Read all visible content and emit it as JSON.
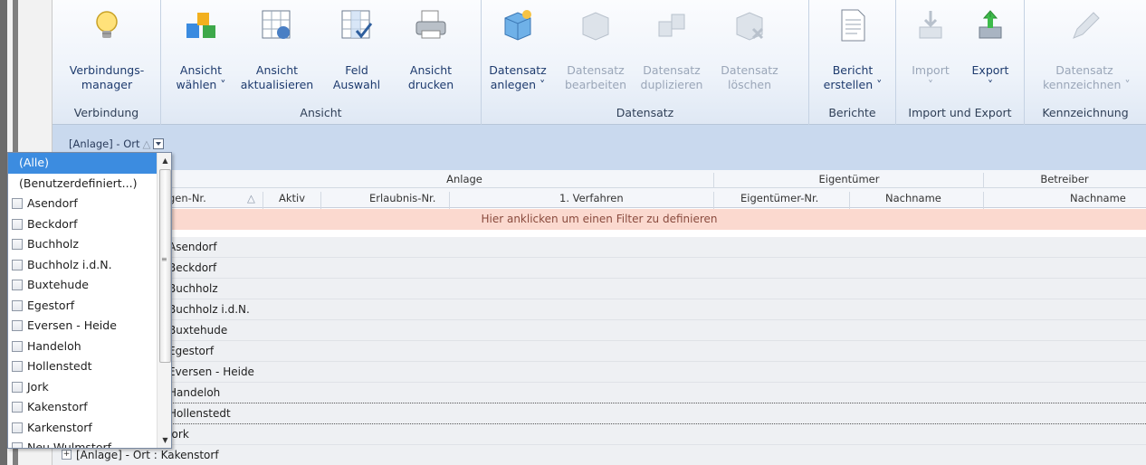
{
  "ribbon": {
    "groups": [
      {
        "label": "Verbindung"
      },
      {
        "label": "Ansicht"
      },
      {
        "label": "Datensatz"
      },
      {
        "label": "Berichte"
      },
      {
        "label": "Import und Export"
      },
      {
        "label": "Kennzeichnung"
      }
    ],
    "buttons": {
      "verbindungsmanager": {
        "line1": "Verbindungs-",
        "line2": "manager"
      },
      "ansicht_waehlen": {
        "line1": "Ansicht",
        "line2": "wählen ˅"
      },
      "ansicht_aktualisieren": {
        "line1": "Ansicht",
        "line2": "aktualisieren"
      },
      "feld_auswahl": {
        "line1": "Feld",
        "line2": "Auswahl"
      },
      "ansicht_drucken": {
        "line1": "Ansicht",
        "line2": "drucken"
      },
      "datensatz_anlegen": {
        "line1": "Datensatz",
        "line2": "anlegen ˅"
      },
      "datensatz_bearbeiten": {
        "line1": "Datensatz",
        "line2": "bearbeiten"
      },
      "datensatz_duplizieren": {
        "line1": "Datensatz",
        "line2": "duplizieren"
      },
      "datensatz_loeschen": {
        "line1": "Datensatz",
        "line2": "löschen"
      },
      "bericht_erstellen": {
        "line1": "Bericht",
        "line2": "erstellen ˅"
      },
      "import": {
        "line1": "Import",
        "line2": "˅"
      },
      "export": {
        "line1": "Export",
        "line2": "˅"
      },
      "datensatz_kennzeichnen": {
        "line1": "Datensatz",
        "line2": "kennzeichnen ˅"
      }
    }
  },
  "groupby": {
    "label": "[Anlage] - Ort",
    "sort_glyph": "△"
  },
  "bands": {
    "anlage": "Anlage",
    "eigentuemer": "Eigentümer",
    "betreiber": "Betreiber"
  },
  "columns": {
    "anlagen_nr": "gen-Nr.",
    "anlagen_nr_sort": "△",
    "aktiv": "Aktiv",
    "erlaubnis_nr": "Erlaubnis-Nr.",
    "verfahren": "1. Verfahren",
    "eigentuemer_nr": "Eigentümer-Nr.",
    "nachname_eig": "Nachname",
    "nachname_betr": "Nachname"
  },
  "filter_row": {
    "text": "Hier anklicken um einen Filter zu definieren"
  },
  "rows": [
    {
      "label": "Asendorf"
    },
    {
      "label": "Beckdorf"
    },
    {
      "label": "Buchholz"
    },
    {
      "label": "Buchholz i.d.N."
    },
    {
      "label": "Buxtehude"
    },
    {
      "label": "Egestorf"
    },
    {
      "label": "Eversen - Heide"
    },
    {
      "label": "Handeloh"
    },
    {
      "label": "Hollenstedt"
    },
    {
      "label": "Jork"
    },
    {
      "label": "[Anlage] - Ort : Kakenstorf"
    }
  ],
  "dropdown": {
    "items": [
      {
        "label": "(Alle)",
        "selected": true,
        "checkbox": false
      },
      {
        "label": "(Benutzerdefiniert...)",
        "selected": false,
        "checkbox": false
      },
      {
        "label": "Asendorf",
        "selected": false,
        "checkbox": true
      },
      {
        "label": "Beckdorf",
        "selected": false,
        "checkbox": true
      },
      {
        "label": "Buchholz",
        "selected": false,
        "checkbox": true
      },
      {
        "label": "Buchholz i.d.N.",
        "selected": false,
        "checkbox": true
      },
      {
        "label": "Buxtehude",
        "selected": false,
        "checkbox": true
      },
      {
        "label": "Egestorf",
        "selected": false,
        "checkbox": true
      },
      {
        "label": "Eversen - Heide",
        "selected": false,
        "checkbox": true
      },
      {
        "label": "Handeloh",
        "selected": false,
        "checkbox": true
      },
      {
        "label": "Hollenstedt",
        "selected": false,
        "checkbox": true
      },
      {
        "label": "Jork",
        "selected": false,
        "checkbox": true
      },
      {
        "label": "Kakenstorf",
        "selected": false,
        "checkbox": true
      },
      {
        "label": "Karkenstorf",
        "selected": false,
        "checkbox": true
      },
      {
        "label": "Neu Wulmstorf",
        "selected": false,
        "checkbox": true
      }
    ]
  },
  "colors": {
    "accent": "#3c8ce0",
    "filter_row": "#fbd9cf",
    "ribbon_text": "#1e3b6e"
  }
}
